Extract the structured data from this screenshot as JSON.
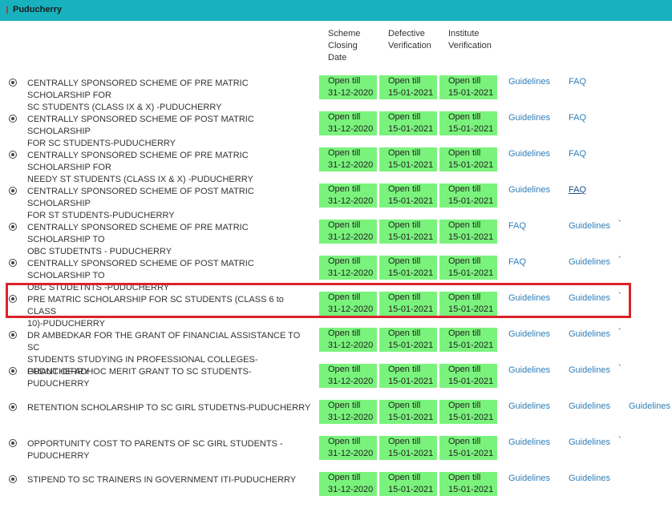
{
  "header": {
    "title": "Puducherry"
  },
  "columns": {
    "closing": [
      "Scheme",
      "Closing",
      "Date"
    ],
    "defective": [
      "Defective",
      "Verification"
    ],
    "institute": [
      "Institute",
      "Verification"
    ]
  },
  "schemes": [
    {
      "name": [
        "CENTRALLY SPONSORED SCHEME OF PRE MATRIC SCHOLARSHIP FOR",
        "SC STUDENTS (CLASS IX & X) -PUDUCHERRY"
      ],
      "closing": [
        "Open till",
        "31-12-2020"
      ],
      "defective": [
        "Open till",
        "15-01-2021"
      ],
      "institute": [
        "Open till",
        "15-01-2021"
      ],
      "link1": "Guidelines",
      "link2": "FAQ",
      "link3": "",
      "tick": ""
    },
    {
      "name": [
        "CENTRALLY SPONSORED SCHEME OF POST MATRIC SCHOLARSHIP",
        "FOR SC STUDENTS-PUDUCHERRY"
      ],
      "closing": [
        "Open till",
        "31-12-2020"
      ],
      "defective": [
        "Open till",
        "15-01-2021"
      ],
      "institute": [
        "Open till",
        "15-01-2021"
      ],
      "link1": "Guidelines",
      "link2": "FAQ",
      "link3": "",
      "tick": ""
    },
    {
      "name": [
        "CENTRALLY SPONSORED SCHEME OF PRE MATRIC SCHOLARSHIP FOR",
        "NEEDY ST STUDENTS (CLASS IX & X) -PUDUCHERRY"
      ],
      "closing": [
        "Open till",
        "31-12-2020"
      ],
      "defective": [
        "Open till",
        "15-01-2021"
      ],
      "institute": [
        "Open till",
        "15-01-2021"
      ],
      "link1": "Guidelines",
      "link2": "FAQ",
      "link3": "",
      "tick": ""
    },
    {
      "name": [
        "CENTRALLY SPONSORED SCHEME OF POST MATRIC SCHOLARSHIP",
        "FOR ST STUDENTS-PUDUCHERRY"
      ],
      "closing": [
        "Open till",
        "31-12-2020"
      ],
      "defective": [
        "Open till",
        "15-01-2021"
      ],
      "institute": [
        "Open till",
        "15-01-2021"
      ],
      "link1": "Guidelines",
      "link2": "FAQ",
      "link3": "",
      "tick": ""
    },
    {
      "name": [
        "CENTRALLY SPONSORED SCHEME OF PRE MATRIC SCHOLARSHIP TO",
        "OBC STUDETNTS - PUDUCHERRY"
      ],
      "closing": [
        "Open till",
        "31-12-2020"
      ],
      "defective": [
        "Open till",
        "15-01-2021"
      ],
      "institute": [
        "Open till",
        "15-01-2021"
      ],
      "link1": "FAQ",
      "link2": "Guidelines",
      "link3": "",
      "tick": "`"
    },
    {
      "name": [
        "CENTRALLY SPONSORED SCHEME OF POST MATRIC SCHOLARSHIP TO",
        "OBC STUDETNTS -PUDUCHERRY"
      ],
      "closing": [
        "Open till",
        "31-12-2020"
      ],
      "defective": [
        "Open till",
        "15-01-2021"
      ],
      "institute": [
        "Open till",
        "15-01-2021"
      ],
      "link1": "FAQ",
      "link2": "Guidelines",
      "link3": "",
      "tick": "`"
    },
    {
      "name": [
        "PRE MATRIC SCHOLARSHIP FOR SC STUDENTS (CLASS 6 to CLASS",
        "10)-PUDUCHERRY"
      ],
      "closing": [
        "Open till",
        "31-12-2020"
      ],
      "defective": [
        "Open till",
        "15-01-2021"
      ],
      "institute": [
        "Open till",
        "15-01-2021"
      ],
      "link1": "Guidelines",
      "link2": "Guidelines",
      "link3": "",
      "tick": "`"
    },
    {
      "name": [
        "DR AMBEDKAR FOR THE GRANT OF FINANCIAL ASSISTANCE TO SC",
        "STUDENTS STUDYING IN PROFESSIONAL COLLEGES-PUDUCHERRY"
      ],
      "closing": [
        "Open till",
        "31-12-2020"
      ],
      "defective": [
        "Open till",
        "15-01-2021"
      ],
      "institute": [
        "Open till",
        "15-01-2021"
      ],
      "link1": "Guidelines",
      "link2": "Guidelines",
      "link3": "",
      "tick": "`"
    },
    {
      "name": [
        "GRANT OF ADHOC MERIT GRANT TO SC STUDENTS-PUDUCHERRY",
        ""
      ],
      "closing": [
        "Open till",
        "31-12-2020"
      ],
      "defective": [
        "Open till",
        "15-01-2021"
      ],
      "institute": [
        "Open till",
        "15-01-2021"
      ],
      "link1": "Guidelines",
      "link2": "Guidelines",
      "link3": "",
      "tick": "`"
    },
    {
      "name": [
        "RETENTION SCHOLARSHIP TO SC GIRL STUDETNS-PUDUCHERRY",
        ""
      ],
      "closing": [
        "Open till",
        "31-12-2020"
      ],
      "defective": [
        "Open till",
        "15-01-2021"
      ],
      "institute": [
        "Open till",
        "15-01-2021"
      ],
      "link1": "Guidelines",
      "link2": "Guidelines",
      "link3": "Guidelines",
      "tick": ""
    },
    {
      "name": [
        "OPPORTUNITY COST TO PARENTS OF SC GIRL STUDENTS -",
        "PUDUCHERRY"
      ],
      "closing": [
        "Open till",
        "31-12-2020"
      ],
      "defective": [
        "Open till",
        "15-01-2021"
      ],
      "institute": [
        "Open till",
        "15-01-2021"
      ],
      "link1": "Guidelines",
      "link2": "Guidelines",
      "link3": "",
      "tick": "`"
    },
    {
      "name": [
        "STIPEND TO SC TRAINERS IN GOVERNMENT ITI-PUDUCHERRY",
        ""
      ],
      "closing": [
        "Open till",
        "31-12-2020"
      ],
      "defective": [
        "Open till",
        "15-01-2021"
      ],
      "institute": [
        "Open till",
        "15-01-2021"
      ],
      "link1": "Guidelines",
      "link2": "Guidelines",
      "link3": "",
      "tick": ""
    }
  ]
}
